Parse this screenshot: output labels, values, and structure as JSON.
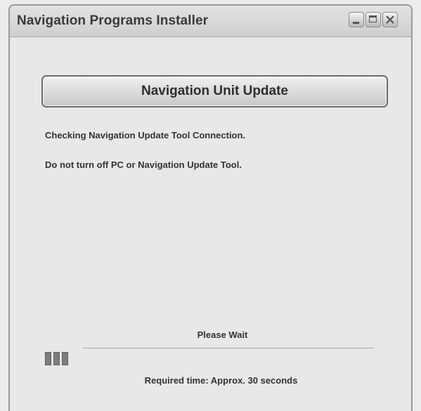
{
  "window": {
    "title": "Navigation Programs Installer",
    "controls": {
      "minimize_icon": "minimize-icon",
      "maximize_icon": "maximize-icon",
      "close_icon": "close-icon"
    }
  },
  "header": {
    "title": "Navigation Unit Update"
  },
  "messages": {
    "status": "Checking Navigation Update Tool Connection.",
    "warning": "Do not turn off PC or Navigation Update Tool."
  },
  "progress": {
    "label": "Please Wait",
    "blocks_filled": 3,
    "required_time": "Required time: Approx. 30 seconds"
  },
  "colors": {
    "progress_block": "#7d7d7d",
    "window_background": "#e8e8e8"
  }
}
